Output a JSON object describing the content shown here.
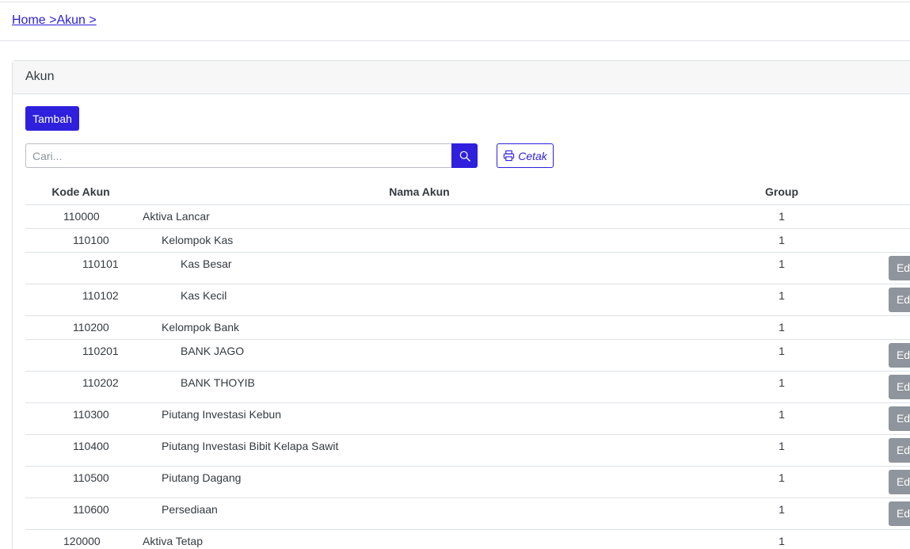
{
  "breadcrumb": {
    "home": "Home >",
    "akun": "Akun >"
  },
  "card": {
    "title": "Akun"
  },
  "toolbar": {
    "tambah_label": "Tambah",
    "cetak_label": "Cetak"
  },
  "search": {
    "placeholder": "Cari..."
  },
  "table": {
    "headers": {
      "kode": "Kode Akun",
      "nama": "Nama Akun",
      "group": "Group"
    },
    "edit_label": "Edit",
    "rows": [
      {
        "kode": "110000",
        "nama": "Aktiva Lancar",
        "group": "1",
        "level": 0,
        "editable": false
      },
      {
        "kode": "110100",
        "nama": "Kelompok Kas",
        "group": "1",
        "level": 1,
        "editable": false
      },
      {
        "kode": "110101",
        "nama": "Kas Besar",
        "group": "1",
        "level": 2,
        "editable": true
      },
      {
        "kode": "110102",
        "nama": "Kas Kecil",
        "group": "1",
        "level": 2,
        "editable": true
      },
      {
        "kode": "110200",
        "nama": "Kelompok Bank",
        "group": "1",
        "level": 1,
        "editable": false
      },
      {
        "kode": "110201",
        "nama": "BANK JAGO",
        "group": "1",
        "level": 2,
        "editable": true
      },
      {
        "kode": "110202",
        "nama": "BANK THOYIB",
        "group": "1",
        "level": 2,
        "editable": true
      },
      {
        "kode": "110300",
        "nama": "Piutang Investasi Kebun",
        "group": "1",
        "level": 1,
        "editable": true
      },
      {
        "kode": "110400",
        "nama": "Piutang Investasi Bibit Kelapa Sawit",
        "group": "1",
        "level": 1,
        "editable": true
      },
      {
        "kode": "110500",
        "nama": "Piutang Dagang",
        "group": "1",
        "level": 1,
        "editable": true
      },
      {
        "kode": "110600",
        "nama": "Persediaan",
        "group": "1",
        "level": 1,
        "editable": true
      },
      {
        "kode": "120000",
        "nama": "Aktiva Tetap",
        "group": "1",
        "level": 0,
        "editable": false
      }
    ]
  },
  "colors": {
    "primary": "#2e20dc",
    "edit_button": "#8e959c",
    "link": "#2a1fd6"
  },
  "icons": {
    "search": "search-icon",
    "print": "printer-icon"
  }
}
